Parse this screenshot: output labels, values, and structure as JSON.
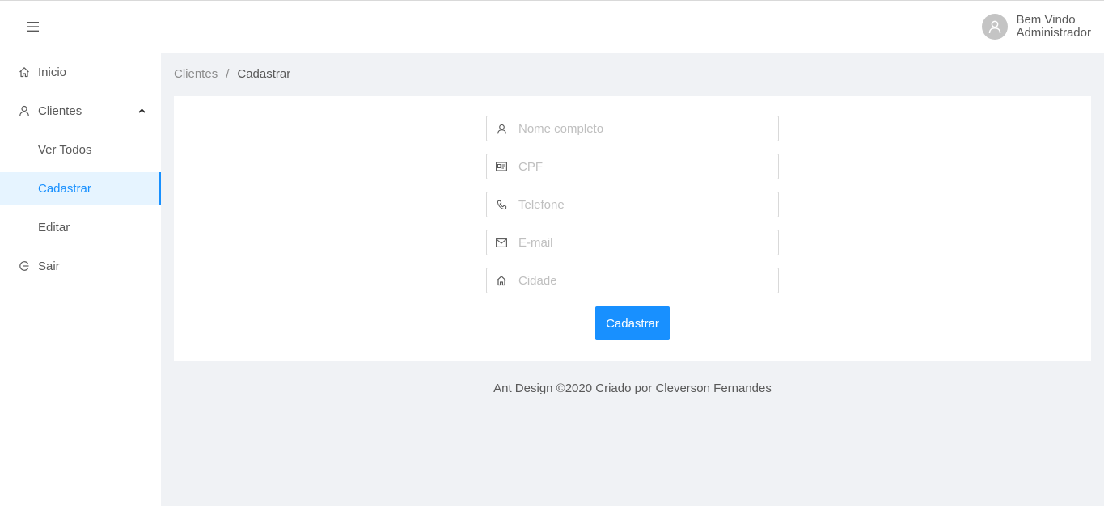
{
  "header": {
    "welcome_line1": "Bem Vindo",
    "welcome_line2": "Administrador"
  },
  "sidebar": {
    "items": [
      {
        "label": "Inicio",
        "icon": "home-icon"
      },
      {
        "label": "Clientes",
        "icon": "user-icon",
        "expanded": true
      },
      {
        "label": "Ver Todos"
      },
      {
        "label": "Cadastrar",
        "active": true
      },
      {
        "label": "Editar"
      },
      {
        "label": "Sair",
        "icon": "logout-icon"
      }
    ]
  },
  "breadcrumb": {
    "parent": "Clientes",
    "separator": "/",
    "current": "Cadastrar"
  },
  "form": {
    "fields": [
      {
        "placeholder": "Nome completo",
        "value": "",
        "icon": "user-icon"
      },
      {
        "placeholder": "CPF",
        "value": "",
        "icon": "idcard-icon"
      },
      {
        "placeholder": "Telefone",
        "value": "",
        "icon": "phone-icon"
      },
      {
        "placeholder": "E-mail",
        "value": "",
        "icon": "mail-icon"
      },
      {
        "placeholder": "Cidade",
        "value": "",
        "icon": "home-icon"
      }
    ],
    "submit_label": "Cadastrar"
  },
  "footer": {
    "text": "Ant Design ©2020 Criado por Cleverson Fernandes"
  },
  "colors": {
    "primary": "#1890ff",
    "background": "#f0f2f5",
    "active_bg": "#e6f4ff"
  }
}
